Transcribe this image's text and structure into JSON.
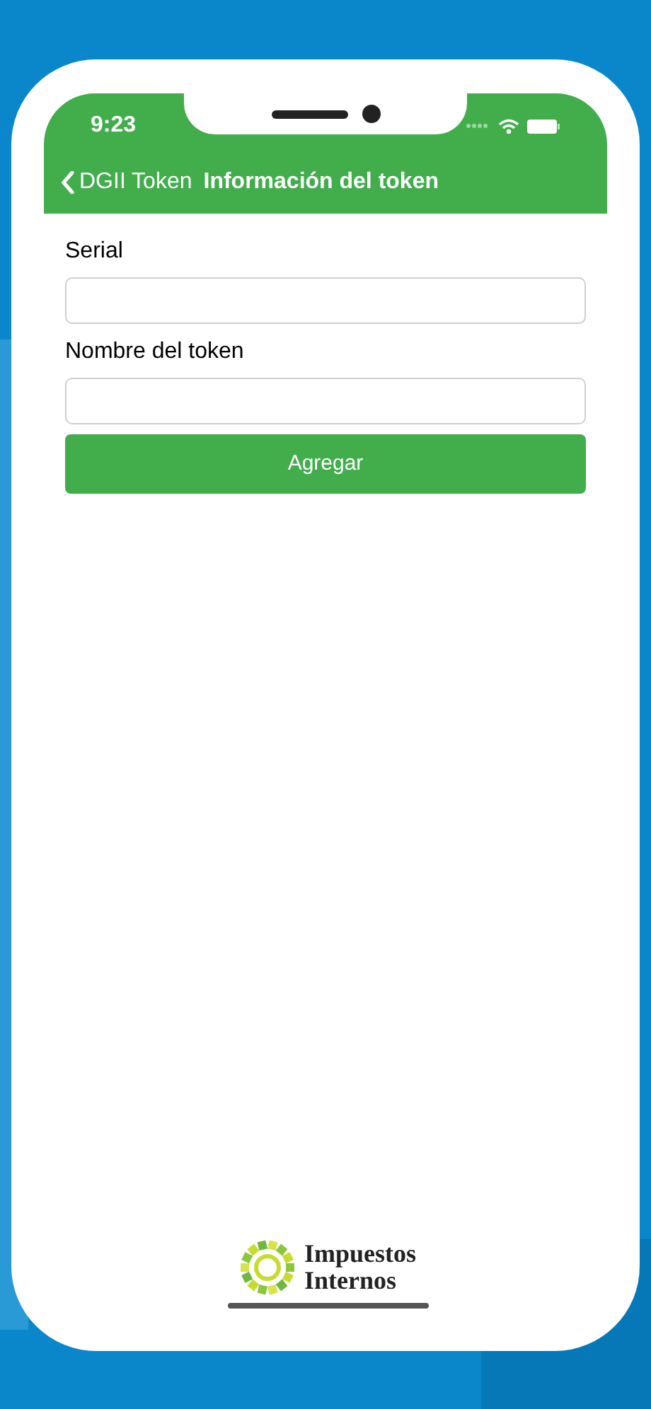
{
  "status_bar": {
    "time": "9:23"
  },
  "nav_bar": {
    "back_label": "DGII Token",
    "title": "Información del token"
  },
  "fields": [
    {
      "label": "Serial"
    },
    {
      "label": "Nombre del token"
    }
  ],
  "button": "Agregar",
  "logo": {
    "lines": [
      "Impuestos",
      "Internos"
    ]
  }
}
